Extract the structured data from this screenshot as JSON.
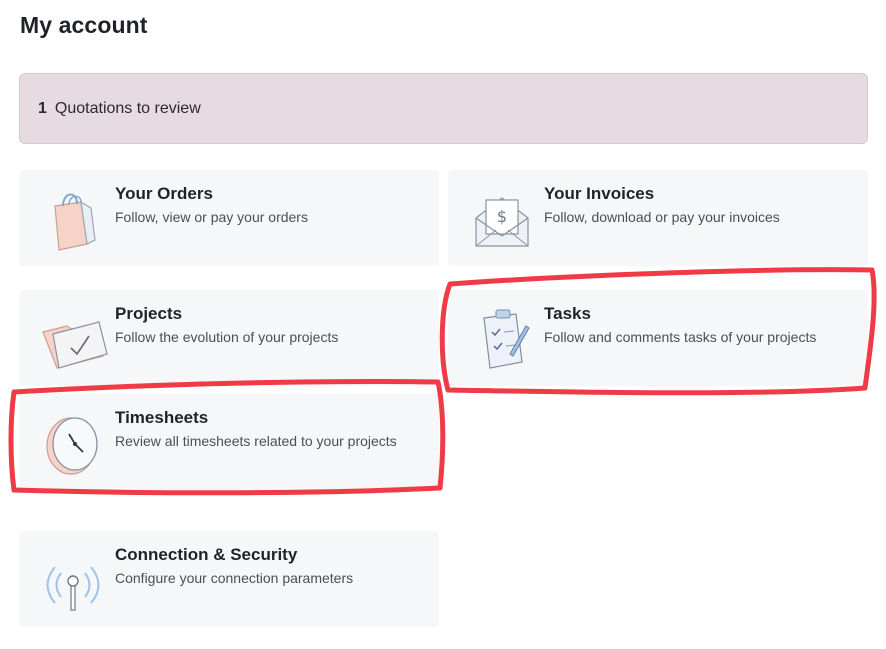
{
  "page": {
    "title": "My account"
  },
  "alert": {
    "count": "1",
    "label": "Quotations to review"
  },
  "cards": [
    {
      "id": "orders",
      "icon": "shopping-bag-icon",
      "title": "Your Orders",
      "description": "Follow, view or pay your orders"
    },
    {
      "id": "invoices",
      "icon": "invoice-envelope-icon",
      "title": "Your Invoices",
      "description": "Follow, download or pay your invoices"
    },
    {
      "id": "projects",
      "icon": "folder-check-icon",
      "title": "Projects",
      "description": "Follow the evolution of your projects"
    },
    {
      "id": "tasks",
      "icon": "clipboard-tasks-icon",
      "title": "Tasks",
      "description": "Follow and comments tasks of your projects"
    },
    {
      "id": "timesheets",
      "icon": "clock-icon",
      "title": "Timesheets",
      "description": "Review all timesheets related to your projects"
    },
    {
      "id": "security",
      "icon": "antenna-signal-icon",
      "title": "Connection & Security",
      "description": "Configure your connection parameters"
    }
  ],
  "colors": {
    "alert_bg": "#e7dbe2",
    "card_bg": "#f6f7f9",
    "highlight": "#ef3b45",
    "icon_accent": "#f4c3b4",
    "icon_blue": "#9fc3e6"
  }
}
